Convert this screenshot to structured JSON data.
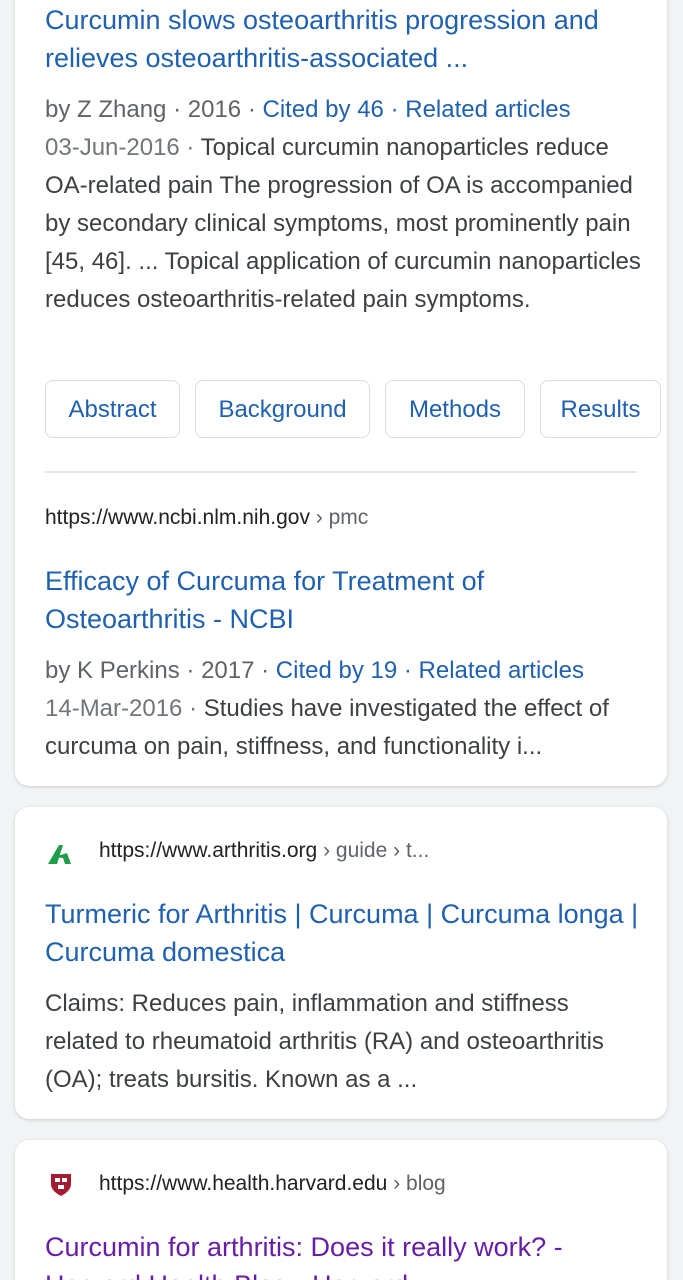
{
  "results": [
    {
      "title": "Curcumin slows osteoarthritis progression and relieves osteoarthritis-associated ...",
      "meta": {
        "author": "by Z Zhang",
        "year": "2016",
        "cited": "Cited by 46",
        "related": "Related articles"
      },
      "date": "03-Jun-2016",
      "snippet": "Topical curcumin nanoparticles reduce OA-related pain The progression of OA is accompanied by secondary clinical symptoms, most prominently pain [45, 46]. ... Topical application of curcumin nanoparticles reduces osteoarthritis-related pain symptoms.",
      "chips": [
        "Abstract",
        "Background",
        "Methods",
        "Results"
      ]
    },
    {
      "url": "https://www.ncbi.nlm.nih.gov",
      "path": "› pmc",
      "title": "Efficacy of Curcuma for Treatment of Osteoarthritis - NCBI",
      "meta": {
        "author": "by K Perkins",
        "year": "2017",
        "cited": "Cited by 19",
        "related": "Related articles"
      },
      "date": "14-Mar-2016",
      "snippet": "Studies have investigated the effect of curcuma on pain, stiffness, and functionality i..."
    },
    {
      "icon": "arthritis-logo-icon",
      "url": "https://www.arthritis.org",
      "path": "› guide › t...",
      "title": "Turmeric for Arthritis | Curcuma | Curcuma longa | Curcuma domestica",
      "snippet": "Claims: Reduces pain, inflammation and stiffness related to rheumatoid arthritis (RA) and osteoarthritis (OA); treats bursitis. Known as a ..."
    },
    {
      "icon": "harvard-shield-icon",
      "url": "https://www.health.harvard.edu",
      "path": "› blog",
      "title": "Curcumin for arthritis: Does it really work? - Harvard Health Blog - Harvard ..."
    }
  ],
  "colors": {
    "link": "#1f61b0",
    "visited_link": "#681da8",
    "arthritis_logo": "#1e9d4a",
    "harvard_shield": "#a51c30"
  }
}
